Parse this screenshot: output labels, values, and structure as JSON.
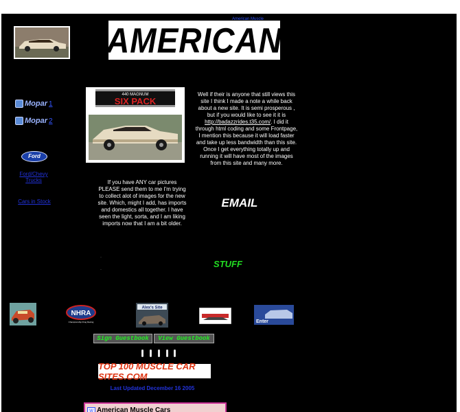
{
  "header": {
    "title": "AMERICAN",
    "corner_link": "American Muscle"
  },
  "sidebar": {
    "mopar_logo_text": "Mopar",
    "mopar_links": [
      {
        "label": "1"
      },
      {
        "label": "2"
      }
    ],
    "ford_logo_text": "Ford",
    "links": [
      {
        "label": "Ford/Chevy Trucks"
      },
      {
        "label": "Cars in Stock"
      }
    ]
  },
  "main": {
    "sixpack_image": {
      "line1": "440 MAGNUM",
      "line2": "SIX PACK"
    },
    "intro_text_before": "Well if their is anyone that still views this site I think I made a note a while back about a new site. It is semi prosperous , but if you would like to see it it is ",
    "intro_link": "http://badazzrides.t35.com/",
    "intro_text_after": ". I did it through html coding and some Frontpage, I mention this because it will load faster and take up less bandwidth than this site. Once I get everything totally up and running it will have most of the images from this site and many more.",
    "request_text": "If you have ANY car pictures PLEASE send them to me I'm trying to collect alot of images for the new site. Which, might I add, has imports and domestics all together. I have seen the light, sorta, and I am liking imports now that I am a bit older.",
    "email_label": "EMAIL",
    "stuff_label": "STUFF"
  },
  "logos": {
    "nhra": "NHRA",
    "nhra_sub": "Championship Drug Racing",
    "alex_site": "Alex's Site",
    "enter": "Enter"
  },
  "guestbook": {
    "sign_label": "Sign Guestbook",
    "view_label": "View Guestbook"
  },
  "top100": {
    "label": "TOP 100 MUSCLE CAR SITES.COM"
  },
  "footer": {
    "last_updated": "Last Updated December 16 2005"
  },
  "webring": {
    "label": "American Muscle Cars"
  }
}
